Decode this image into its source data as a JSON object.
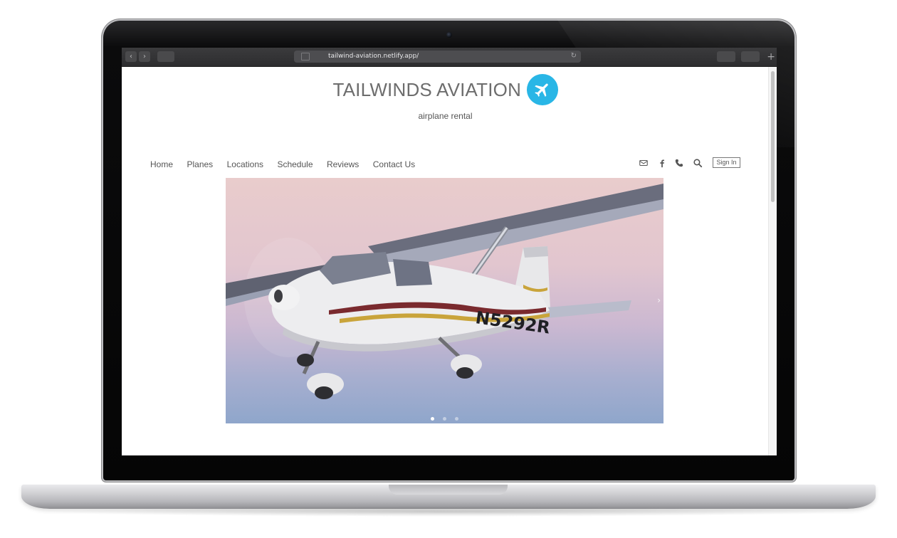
{
  "browser": {
    "url": "tailwind-aviation.netlify.app/",
    "back_glyph": "‹",
    "forward_glyph": "›",
    "reload_glyph": "↻",
    "new_tab_glyph": "+"
  },
  "site": {
    "title": "TAILWINDS AVIATION",
    "tagline": "airplane rental",
    "logo_icon": "airplane-icon",
    "accent_color": "#29b6e6"
  },
  "nav": {
    "items": [
      "Home",
      "Planes",
      "Locations",
      "Schedule",
      "Reviews",
      "Contact Us"
    ],
    "icons": [
      "mail-icon",
      "facebook-icon",
      "phone-icon",
      "search-icon"
    ],
    "sign_in": "Sign In"
  },
  "hero": {
    "tail_number": "N5292R",
    "slide_count": 3,
    "active_slide": 1,
    "next_glyph": "›"
  }
}
